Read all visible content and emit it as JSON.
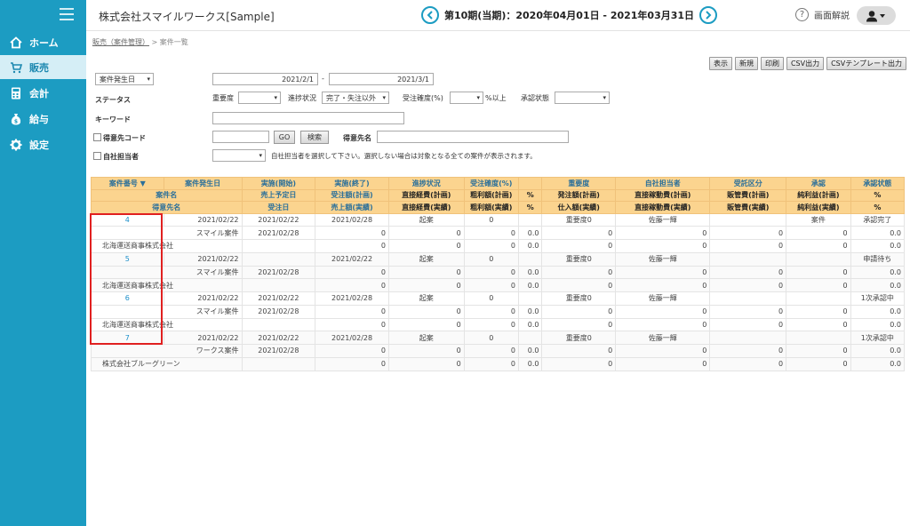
{
  "sidebar": {
    "items": [
      {
        "label": "ホーム",
        "icon": "home-icon"
      },
      {
        "label": "販売",
        "icon": "cart-icon"
      },
      {
        "label": "会計",
        "icon": "calculator-icon"
      },
      {
        "label": "給与",
        "icon": "money-bag-icon"
      },
      {
        "label": "設定",
        "icon": "gear-icon"
      }
    ]
  },
  "header": {
    "company": "株式会社スマイルワークス[Sample]",
    "period": "第10期(当期)：2020年04月01日 - 2021年03月31日",
    "help": "画面解説"
  },
  "breadcrumb": {
    "link": "販売（案件管理）",
    "sep": ">",
    "current": "案件一覧"
  },
  "actions": [
    "表示",
    "新規",
    "印刷",
    "CSV出力",
    "CSVテンプレート出力"
  ],
  "filters": {
    "date_type": "案件発生日",
    "date_from": "2021/2/1",
    "date_sep": "-",
    "date_to": "2021/3/1",
    "status_label": "ステータス",
    "importance_label": "重要度",
    "importance_value": "",
    "progress_label": "進捗状況",
    "progress_value": "完了・失注以外",
    "probability_label": "受注確度(%)",
    "probability_value": "",
    "probability_suffix": "%以上",
    "approval_label": "承認状態",
    "approval_value": "",
    "keyword_label": "キーワード",
    "keyword_value": "",
    "client_code_label": "得意先コード",
    "client_code_value": "",
    "go_label": "GO",
    "search_label": "検索",
    "client_name_label": "得意先名",
    "client_name_value": "",
    "staff_label": "自社担当者",
    "staff_value": "",
    "staff_note": "自社担当者を選択して下さい。選択しない場合は対象となる全ての案件が表示されます。"
  },
  "table": {
    "headers": [
      [
        "案件番号 ▼",
        "案件発生日",
        "実施(開始)",
        "実施(終了)",
        "進捗状況",
        "受注確度(%)",
        "",
        "重要度",
        "自社担当者",
        "受託区分",
        "承認",
        "承認状態"
      ],
      [
        "案件名",
        "",
        "売上予定日",
        "受注額(計画)",
        "直接経費(計画)",
        "粗利額(計画)",
        "%",
        "発注額(計画)",
        "直接稼動費(計画)",
        "販管費(計画)",
        "純利益(計画)",
        "%"
      ],
      [
        "得意先名",
        "",
        "受注日",
        "売上額(実績)",
        "直接経費(実績)",
        "粗利額(実績)",
        "%",
        "仕入額(実績)",
        "直接稼動費(実績)",
        "販管費(実績)",
        "純利益(実績)",
        "%"
      ]
    ],
    "records": [
      {
        "no": "4",
        "date": "2021/02/22",
        "start": "2021/02/22",
        "end": "2021/02/28",
        "progress": "起案",
        "prob": "0",
        "importance": "重要度0",
        "staff": "佐藤一輝",
        "approval": "案件",
        "status": "承認完了",
        "name": "スマイル案件",
        "sales_date": "2021/02/28",
        "client": "北海運送商事株式会社"
      },
      {
        "no": "5",
        "date": "2021/02/22",
        "start": "",
        "end": "2021/02/22",
        "progress": "起案",
        "prob": "0",
        "importance": "重要度0",
        "staff": "佐藤一輝",
        "approval": "",
        "status": "申請待ち",
        "name": "スマイル案件",
        "sales_date": "2021/02/28",
        "client": "北海運送商事株式会社"
      },
      {
        "no": "6",
        "date": "2021/02/22",
        "start": "2021/02/22",
        "end": "2021/02/28",
        "progress": "起案",
        "prob": "0",
        "importance": "重要度0",
        "staff": "佐藤一輝",
        "approval": "",
        "status": "1次承認中",
        "name": "スマイル案件",
        "sales_date": "2021/02/28",
        "client": "北海運送商事株式会社"
      },
      {
        "no": "7",
        "date": "2021/02/22",
        "start": "2021/02/22",
        "end": "2021/02/28",
        "progress": "起案",
        "prob": "0",
        "importance": "重要度0",
        "staff": "佐藤一輝",
        "approval": "",
        "status": "1次承認中",
        "name": "ワークス案件",
        "sales_date": "2021/02/28",
        "client": "株式会社ブルーグリーン"
      }
    ],
    "zero": "0",
    "zero_pct": "0.0"
  },
  "colors": {
    "sidebar": "#1c9cc2",
    "header_bg": "#fbd48f",
    "header_text": "#2a6f9a",
    "highlight": "#e02020"
  }
}
